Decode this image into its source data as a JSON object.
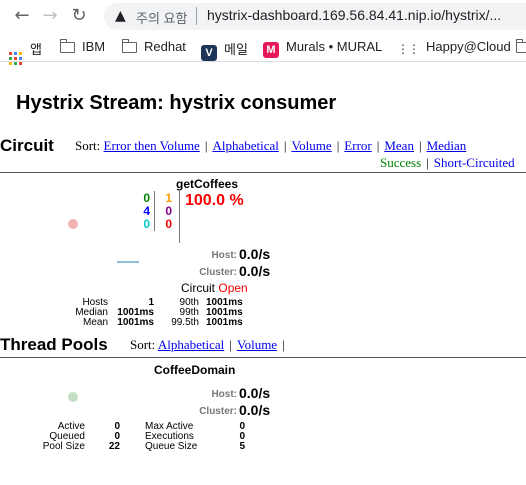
{
  "browser": {
    "back_icon": "arrow-left-icon",
    "forward_icon": "arrow-right-icon",
    "reload_icon": "reload-icon",
    "security_warning": "주의 요함",
    "url": "hystrix-dashboard.169.56.84.41.nip.io/hystrix/...",
    "bookmarks": [
      {
        "label": "앱",
        "icon": "apps-grid-icon"
      },
      {
        "label": "IBM",
        "icon": "folder-icon"
      },
      {
        "label": "Redhat",
        "icon": "folder-icon"
      },
      {
        "label": "메일",
        "icon": "v-logo-icon"
      },
      {
        "label": "Murals • MURAL",
        "icon": "mural-icon"
      },
      {
        "label": "Happy@Cloud",
        "icon": "dots-icon"
      }
    ]
  },
  "page": {
    "title": "Hystrix Stream: hystrix consumer"
  },
  "circuit_section": {
    "title": "Circuit",
    "sort_label": "Sort:",
    "sort_links": [
      "Error then Volume",
      "Alphabetical",
      "Volume",
      "Error",
      "Mean",
      "Median"
    ],
    "legend": {
      "success": "Success",
      "short_circuited": "Short-Circuited",
      "success_color": "#008000",
      "short_circuited_color": "#0000ee"
    }
  },
  "circuit": {
    "name": "getCoffees",
    "error_rate": "100.0 %",
    "counts": {
      "success": "0",
      "short_circuited": "4",
      "bad_request": "0",
      "timeout": "1",
      "rejected": "0",
      "failure": "0"
    },
    "count_colors": {
      "success": "#008000",
      "short_circuited": "#0000ff",
      "bad_request": "#00cccc",
      "timeout": "#ff9900",
      "rejected": "#800080",
      "failure": "#ff0000"
    },
    "host_label": "Host:",
    "host_rate": "0.0/s",
    "cluster_label": "Cluster:",
    "cluster_rate": "0.0/s",
    "circuit_label": "Circuit",
    "circuit_status": "Open",
    "stats": {
      "hosts_label": "Hosts",
      "hosts": "1",
      "median_label": "Median",
      "median": "1001ms",
      "mean_label": "Mean",
      "mean": "1001ms",
      "p90_label": "90th",
      "p90": "1001ms",
      "p99_label": "99th",
      "p99": "1001ms",
      "p995_label": "99.5th",
      "p995": "1001ms"
    }
  },
  "thread_section": {
    "title": "Thread Pools",
    "sort_label": "Sort:",
    "sort_links": [
      "Alphabetical",
      "Volume"
    ]
  },
  "thread_pool": {
    "name": "CoffeeDomain",
    "host_label": "Host:",
    "host_rate": "0.0/s",
    "cluster_label": "Cluster:",
    "cluster_rate": "0.0/s",
    "stats": {
      "active_label": "Active",
      "active": "0",
      "queued_label": "Queued",
      "queued": "0",
      "pool_size_label": "Pool Size",
      "pool_size": "22",
      "max_active_label": "Max Active",
      "max_active": "0",
      "executions_label": "Executions",
      "executions": "0",
      "queue_size_label": "Queue Size",
      "queue_size": "5"
    }
  }
}
